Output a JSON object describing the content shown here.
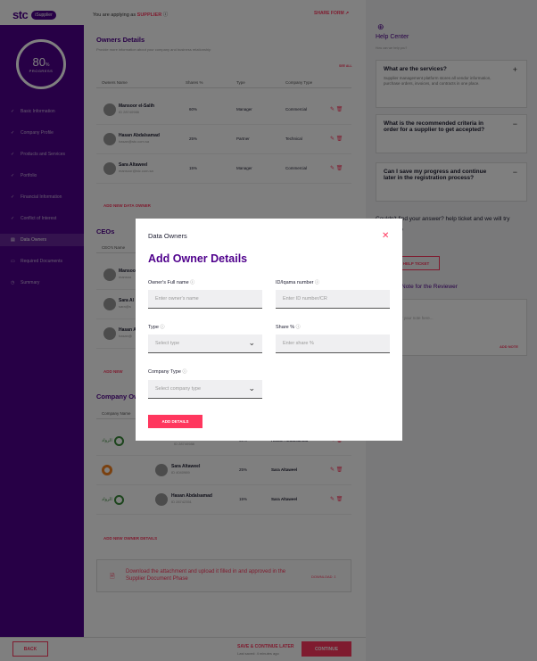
{
  "header": {
    "logo_text": "stc",
    "logo_badge": "iSupplier",
    "applying_prefix": "You are applying as",
    "applying_role": "SUPPLIER",
    "share_form": "SHARE FORM"
  },
  "sidebar": {
    "progress_value": "80",
    "progress_unit": "%",
    "progress_label": "PROGRESS",
    "items": [
      {
        "label": "Basic Information",
        "state": "done"
      },
      {
        "label": "Company Profile",
        "state": "done"
      },
      {
        "label": "Products and Services",
        "state": "done"
      },
      {
        "label": "Portfolio",
        "state": "done"
      },
      {
        "label": "Financial Information",
        "state": "done"
      },
      {
        "label": "Conflict of Interest",
        "state": "done"
      },
      {
        "label": "Data Owners",
        "state": "active"
      },
      {
        "label": "Required Documents",
        "state": "pending"
      },
      {
        "label": "Summary",
        "state": "pending"
      }
    ]
  },
  "owners": {
    "title": "Owners Details",
    "subtitle": "Provide more information about your company and business relationship",
    "see_all": "SEE ALL",
    "columns": [
      "Owners Name",
      "Shares %",
      "Type",
      "Company Type"
    ],
    "rows": [
      {
        "name": "Mansoor el-Salih",
        "sub": "ID 28740988",
        "shares": "60%",
        "type": "Manager",
        "company_type": "Commercial"
      },
      {
        "name": "Hasan Abdalsamad",
        "sub": "hasan@stc.com.sa",
        "shares": "25%",
        "type": "Partner",
        "company_type": "Technical"
      },
      {
        "name": "Sara Altaweel",
        "sub": "mansoor@stc.com.sa",
        "shares": "15%",
        "type": "Manager",
        "company_type": "Commercial"
      }
    ],
    "add_link": "ADD NEW DATA OWNER"
  },
  "ceos": {
    "title": "CEOs",
    "column": "CEO's Name",
    "rows": [
      {
        "name": "Mansoo",
        "sub": "mansoo"
      },
      {
        "name": "Sara Al",
        "sub": "sara@s"
      },
      {
        "name": "Hasan A",
        "sub": "hasan@"
      }
    ],
    "add_link": "ADD NEW"
  },
  "company_owners": {
    "title": "Company Ow",
    "column": "Company Name",
    "rows": [
      {
        "sub": "ID 28740988",
        "shares": "60%",
        "name": "Hasan Abdalsamad"
      },
      {
        "name_main": "Sara Altaweel",
        "sub": "ID 4040989",
        "shares": "25%",
        "name": "Sara Altaweel"
      },
      {
        "name_main": "Hasan Abdalsamad",
        "sub": "ID 28742351",
        "shares": "15%",
        "name": "Sara Altaweel"
      }
    ],
    "add_link": "ADD NEW OWNER DETAILS"
  },
  "download": {
    "text": "Download the attachment and upload it filled in and approved in the Supplier Document Phase",
    "link": "DOWNLOAD"
  },
  "footer": {
    "back": "BACK",
    "save_continue": "SAVE & CONTINUE LATER",
    "last_saved": "Last saved: 4 minutes ago",
    "continue": "CONTINUE"
  },
  "help": {
    "title": "Help Center",
    "subtitle": "How can we help you?",
    "faqs": [
      {
        "q": "What are the services?",
        "a": "Supplier management platform stores all vendor information, purchase orders, invoices, and contracts in one place.",
        "toggle": "+"
      },
      {
        "q": "What is the recommended criteria in order for a supplier to get accepted?",
        "a": "",
        "toggle": "−"
      },
      {
        "q": "Can I save my progress and continue later in the registration process?",
        "a": "",
        "toggle": "−"
      }
    ],
    "couldnt": "Couldn't find your answer? help ticket and we will try our best to",
    "help_ticket": "HELP TICKET",
    "note_title": "Note for the Reviewer",
    "note_placeholder": "r your note here...",
    "add_note": "ADD NOTE"
  },
  "modal": {
    "header": "Data Owners",
    "title": "Add Owner Details",
    "fields": {
      "full_name": {
        "label": "Owner's Full name",
        "placeholder": "Enter owner's name"
      },
      "id_number": {
        "label": "ID/Iqama number",
        "placeholder": "Enter ID number/CR"
      },
      "type": {
        "label": "Type",
        "placeholder": "Select type"
      },
      "share": {
        "label": "Share %",
        "placeholder": "Enter share %"
      },
      "company_type": {
        "label": "Company Type",
        "placeholder": "Select company type"
      }
    },
    "add_button": "ADD DETAILS"
  }
}
